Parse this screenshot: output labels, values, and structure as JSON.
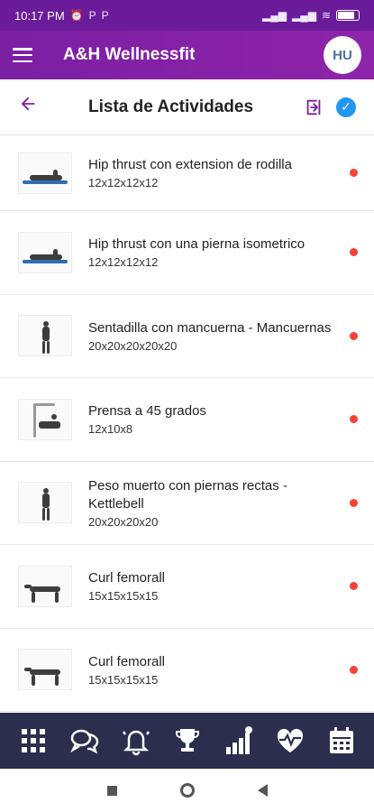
{
  "status_bar": {
    "time": "10:17 PM",
    "icons": [
      "alarm-icon",
      "parking-icon",
      "parking-icon"
    ],
    "battery_level": 0.85
  },
  "app_bar": {
    "title": "A&H Wellnessfit",
    "avatar_initials": "HU"
  },
  "sub_header": {
    "title": "Lista de Actividades"
  },
  "activities": [
    {
      "name": "Hip thrust con extension de rodilla",
      "reps": "12x12x12x12",
      "thumb": "lying"
    },
    {
      "name": "Hip thrust con una pierna isometrico",
      "reps": "12x12x12x12",
      "thumb": "lying"
    },
    {
      "name": "Sentadilla con mancuerna - Mancuernas",
      "reps": "20x20x20x20x20",
      "thumb": "standing"
    },
    {
      "name": "Prensa a 45 grados",
      "reps": "12x10x8",
      "thumb": "machine"
    },
    {
      "name": "Peso muerto con piernas rectas - Kettlebell",
      "reps": "20x20x20x20",
      "thumb": "standing"
    },
    {
      "name": "Curl femorall",
      "reps": "15x15x15x15",
      "thumb": "kneeling"
    },
    {
      "name": "Curl femorall",
      "reps": "15x15x15x15",
      "thumb": "kneeling"
    }
  ],
  "colors": {
    "primary": "#7b1fa2",
    "status_dot": "#f44336",
    "bottom_nav": "#2c2e4d",
    "accent_blue": "#2196f3"
  },
  "bottom_nav": [
    "grid-icon",
    "chat-icon",
    "bell-icon",
    "trophy-icon",
    "stats-icon",
    "heart-rate-icon",
    "calendar-icon"
  ]
}
